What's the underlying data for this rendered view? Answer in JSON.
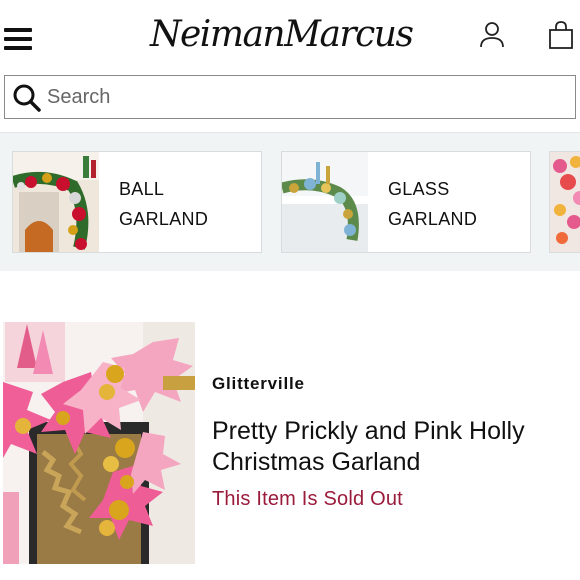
{
  "header": {
    "logo_text": "NeimanMarcus",
    "icons": [
      "menu-icon",
      "account-icon",
      "shopping-bag-icon"
    ]
  },
  "search": {
    "placeholder": "Search",
    "value": ""
  },
  "categories": [
    {
      "line1": "BALL",
      "line2": "GARLAND"
    },
    {
      "line1": "GLASS",
      "line2": "GARLAND"
    }
  ],
  "product": {
    "brand": "Glitterville",
    "name": "Pretty Prickly and Pink Holly Christmas Garland",
    "status": "This Item Is Sold Out"
  },
  "colors": {
    "sold_out": "#9a1b3b",
    "strip_background": "#f1f4f5"
  }
}
